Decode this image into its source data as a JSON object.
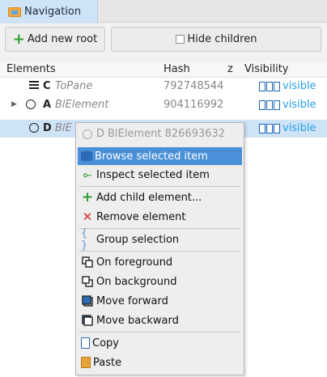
{
  "tab": {
    "label": "Navigation",
    "icon": "folder-icon"
  },
  "toolbar": {
    "add_label": "Add new root",
    "hide_label": "Hide children",
    "hide_checked": false
  },
  "table": {
    "headers": {
      "elements": "Elements",
      "hash": "Hash",
      "z": "z",
      "visibility": "Visibility"
    },
    "rows": [
      {
        "letter": "C",
        "name": "ToPane",
        "hash": "792748544",
        "visibility": "visible",
        "icon": "pane-icon"
      },
      {
        "letter": "A",
        "name": "BlElement",
        "hash": "904116992",
        "visibility": "visible",
        "icon": "circle-icon",
        "expandable": true
      },
      {
        "letter": "D",
        "name": "BlE",
        "hash": "",
        "visibility": "visible",
        "icon": "circle-icon",
        "selected": true
      }
    ]
  },
  "menu": {
    "header": "D BlElement 826693632",
    "items": [
      {
        "label": "Browse selected item",
        "icon": "browse-icon",
        "highlighted": true
      },
      {
        "label": "Inspect selected item",
        "icon": "inspect-icon"
      },
      {
        "label": "Add child element...",
        "icon": "add-icon"
      },
      {
        "label": "Remove element",
        "icon": "remove-icon"
      },
      {
        "label": "Group selection",
        "icon": "group-icon"
      },
      {
        "label": "On foreground",
        "icon": "foreground-icon"
      },
      {
        "label": "On background",
        "icon": "background-icon"
      },
      {
        "label": "Move forward",
        "icon": "move-forward-icon"
      },
      {
        "label": "Move backward",
        "icon": "move-backward-icon"
      },
      {
        "label": "Copy",
        "icon": "copy-icon"
      },
      {
        "label": "Paste",
        "icon": "paste-icon"
      }
    ]
  },
  "colors": {
    "accent": "#4a90d9",
    "selection": "#cfe3f7",
    "visible_text": "#24a0e8",
    "add_green": "#2f9e2f",
    "remove_red": "#d62a2a"
  }
}
